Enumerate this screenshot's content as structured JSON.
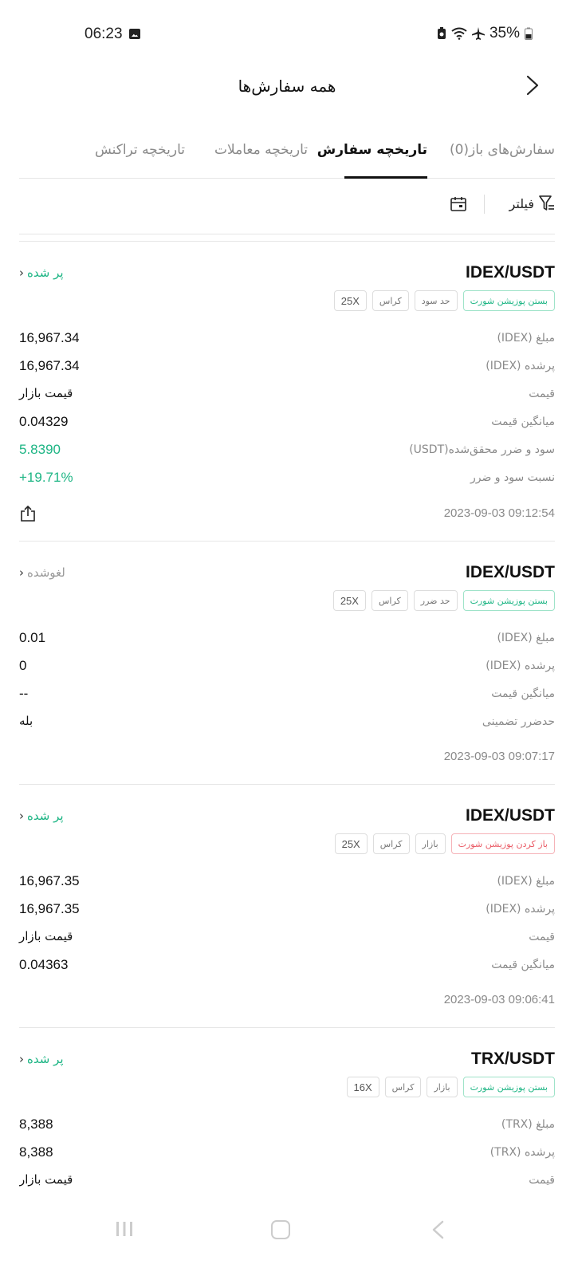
{
  "status_bar": {
    "time": "06:23",
    "battery": "35%"
  },
  "header": {
    "title": "همه سفارش‌ها"
  },
  "tabs": [
    {
      "label": "سفارش‌های باز(0)",
      "active": false
    },
    {
      "label": "تاریخچه سفارش",
      "active": true
    },
    {
      "label": "تاریخچه معاملات",
      "active": false
    },
    {
      "label": "تاریخچه تراکنش",
      "active": false
    }
  ],
  "toolbar": {
    "filter_label": "فیلتر"
  },
  "orders": [
    {
      "pair": "IDEX/USDT",
      "status": "پر شده",
      "tags": [
        "بستن پوزیشن شورت",
        "حد سود",
        "کراس",
        "25X"
      ],
      "rows": [
        {
          "label": "مبلغ (IDEX)",
          "value": "16,967.34"
        },
        {
          "label": "پرشده (IDEX)",
          "value": "16,967.34"
        },
        {
          "label": "قیمت",
          "value": "قیمت بازار"
        },
        {
          "label": "میانگین قیمت",
          "value": "0.04329"
        },
        {
          "label": "سود و ضرر محقق‌شده(USDT)",
          "value": "5.8390"
        },
        {
          "label": "نسبت سود و ضرر",
          "value": "+19.71%"
        }
      ],
      "time": "2023-09-03 09:12:54"
    },
    {
      "pair": "IDEX/USDT",
      "status": "لغوشده",
      "tags": [
        "بستن پوزیشن شورت",
        "حد ضرر",
        "کراس",
        "25X"
      ],
      "rows": [
        {
          "label": "مبلغ (IDEX)",
          "value": "0.01"
        },
        {
          "label": "پرشده (IDEX)",
          "value": "0"
        },
        {
          "label": "میانگین قیمت",
          "value": "--"
        },
        {
          "label": "حدضرر تضمینی",
          "value": "بله"
        }
      ],
      "time": "2023-09-03 09:07:17"
    },
    {
      "pair": "IDEX/USDT",
      "status": "پر شده",
      "tags": [
        "باز کردن پوزیشن شورت",
        "بازار",
        "کراس",
        "25X"
      ],
      "rows": [
        {
          "label": "مبلغ (IDEX)",
          "value": "16,967.35"
        },
        {
          "label": "پرشده (IDEX)",
          "value": "16,967.35"
        },
        {
          "label": "قیمت",
          "value": "قیمت بازار"
        },
        {
          "label": "میانگین قیمت",
          "value": "0.04363"
        }
      ],
      "time": "2023-09-03 09:06:41"
    },
    {
      "pair": "TRX/USDT",
      "status": "پر شده",
      "tags": [
        "بستن پوزیشن شورت",
        "بازار",
        "کراس",
        "16X"
      ],
      "rows": [
        {
          "label": "مبلغ (TRX)",
          "value": "8,388"
        },
        {
          "label": "پرشده (TRX)",
          "value": "8,388"
        },
        {
          "label": "قیمت",
          "value": "قیمت بازار"
        }
      ],
      "time": ""
    }
  ],
  "colors": {
    "green": "#1db584",
    "red": "#ea5b66",
    "text": "#111111",
    "muted": "#8a8a8a"
  }
}
